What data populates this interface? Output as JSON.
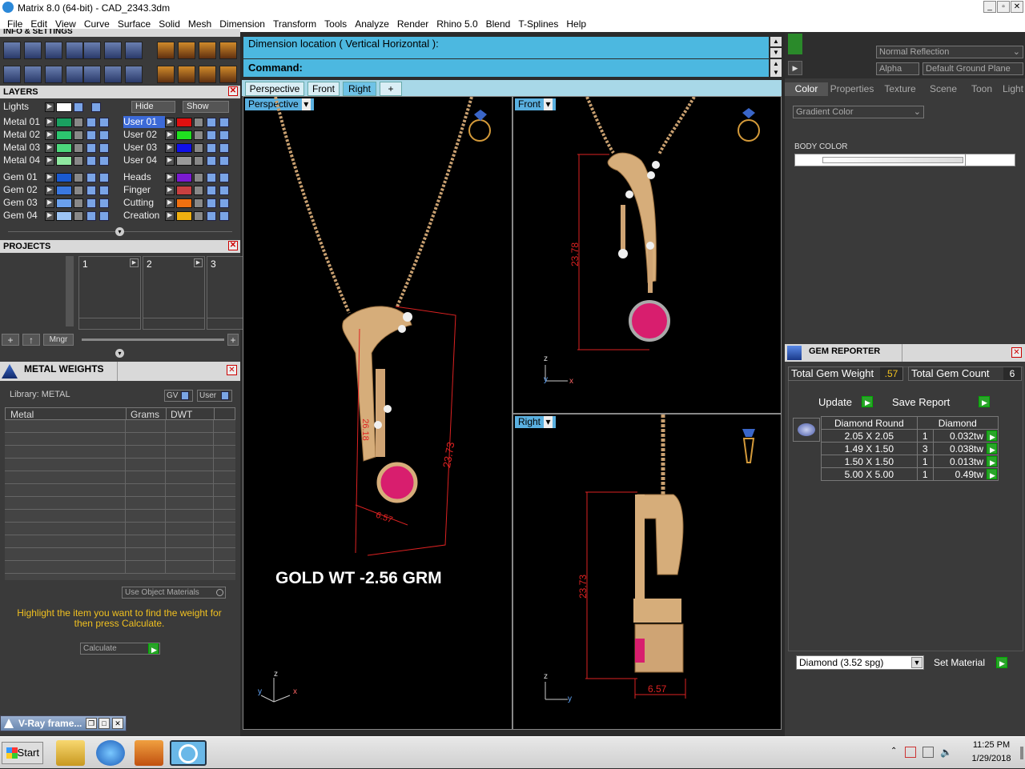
{
  "window": {
    "title": "Matrix 8.0 (64-bit) - CAD_2343.3dm"
  },
  "menu": [
    "File",
    "Edit",
    "View",
    "Curve",
    "Surface",
    "Solid",
    "Mesh",
    "Dimension",
    "Transform",
    "Tools",
    "Analyze",
    "Render",
    "Rhino 5.0",
    "Blend",
    "T-Splines",
    "Help"
  ],
  "left": {
    "info_header": "INFO & SETTINGS",
    "layers_header": "LAYERS",
    "lights": "Lights",
    "hide": "Hide",
    "show": "Show",
    "metals": [
      "Metal 01",
      "Metal 02",
      "Metal 03",
      "Metal 04"
    ],
    "users": [
      "User 01",
      "User 02",
      "User 03",
      "User 04"
    ],
    "gems": [
      "Gem 01",
      "Gem 02",
      "Gem 03",
      "Gem 04"
    ],
    "others": [
      "Heads",
      "Finger",
      "Cutting",
      "Creation"
    ],
    "metal_colors": [
      "#1aa060",
      "#2cc46e",
      "#4cd87c",
      "#8fe8a0"
    ],
    "user_colors": [
      "#e01010",
      "#20e020",
      "#1010e8",
      "#9a9a9a"
    ],
    "gem_colors": [
      "#1a5ad0",
      "#3a78e0",
      "#6aa0ec",
      "#9cc4f4"
    ],
    "other_colors": [
      "#7a1ad0",
      "#c84040",
      "#f07010",
      "#f0b010"
    ],
    "projects_header": "PROJECTS",
    "project_slots": [
      "1",
      "2",
      "3"
    ],
    "mngr": "Mngr",
    "metal_weights_header": "METAL WEIGHTS",
    "library": "Library: METAL",
    "gv": "GV",
    "user_btn": "User",
    "table_headers": [
      "Metal",
      "Grams",
      "DWT"
    ],
    "use_object_materials": "Use Object Materials",
    "instructions": "Highlight the item you want to find the weight for then press Calculate.",
    "calculate": "Calculate",
    "vray": "V-Ray frame..."
  },
  "command": {
    "dimension_prompt": "Dimension location ( Vertical  Horizontal ):",
    "command_label": "Command:"
  },
  "view_tabs": [
    "Perspective",
    "Front",
    "Right",
    "+"
  ],
  "viewports": {
    "perspective": {
      "label": "Perspective",
      "dims": [
        "23.73",
        "26.18",
        "6.57"
      ],
      "overlay": "GOLD WT -2.56 GRM",
      "axes": [
        "z",
        "y",
        "x"
      ]
    },
    "front": {
      "label": "Front",
      "dims": [
        "23.78"
      ],
      "axes": [
        "z",
        "y",
        "x"
      ]
    },
    "right": {
      "label": "Right",
      "dims": [
        "23.73",
        "6.57"
      ],
      "axes": [
        "z",
        "y"
      ]
    }
  },
  "right": {
    "reflection": "Normal Reflection",
    "alpha": "Alpha",
    "ground": "Default Ground Plane",
    "tabs": [
      "Color",
      "Properties",
      "Texture",
      "Scene",
      "Toon",
      "Light"
    ],
    "gradient": "Gradient Color",
    "body_color": "BODY COLOR",
    "gem_reporter_header": "GEM REPORTER",
    "total_weight_label": "Total Gem Weight",
    "total_weight": ".57",
    "total_count_label": "Total Gem Count",
    "total_count": "6",
    "update": "Update",
    "save_report": "Save Report",
    "gem_table_headers": [
      "Diamond Round",
      "Diamond"
    ],
    "gem_rows": [
      {
        "size": "2.05 X 2.05",
        "count": "1",
        "tw": "0.032tw"
      },
      {
        "size": "1.49 X 1.50",
        "count": "3",
        "tw": "0.038tw"
      },
      {
        "size": "1.50 X 1.50",
        "count": "1",
        "tw": "0.013tw"
      },
      {
        "size": "5.00 X 5.00",
        "count": "1",
        "tw": "0.49tw"
      }
    ],
    "material_select": "Diamond    (3.52 spg)",
    "set_material": "Set Material"
  },
  "taskbar": {
    "start": "Start",
    "time": "11:25 PM",
    "date": "1/29/2018"
  }
}
